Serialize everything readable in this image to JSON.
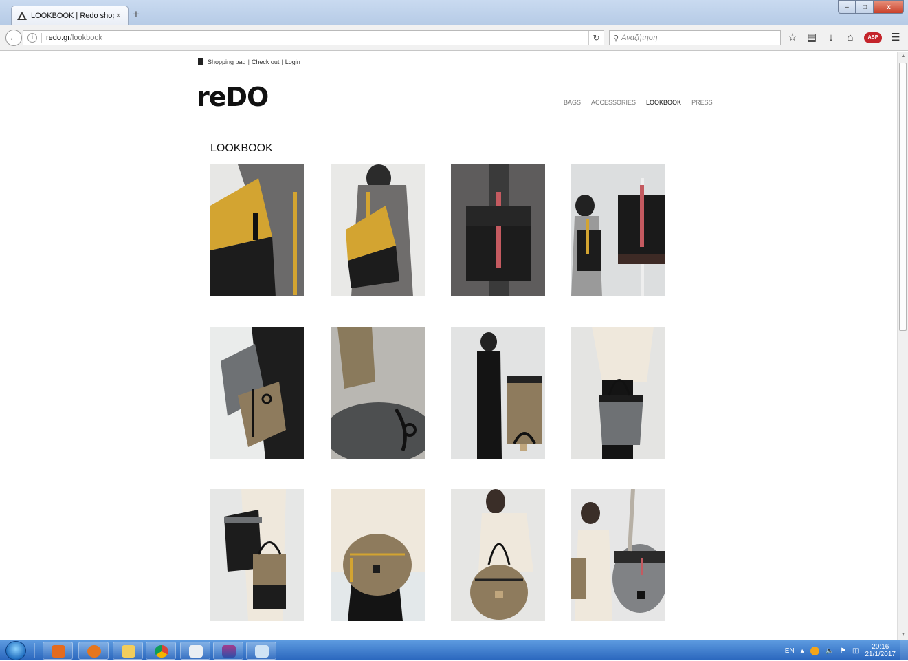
{
  "browser": {
    "tab_title": "LOOKBOOK | Redo shop",
    "tab_close": "×",
    "new_tab": "+",
    "url_host": "redo.gr",
    "url_path": "/lookbook",
    "search_placeholder": "Αναζήτηση",
    "abp_label": "ABP",
    "win_min": "–",
    "win_max": "□",
    "win_close": "x"
  },
  "page": {
    "header_links": {
      "bag": "Shopping bag",
      "checkout": "Check out",
      "login": "Login",
      "divider": "|"
    },
    "logo": "reDO",
    "nav": [
      "BAGS",
      "ACCESSORIES",
      "LOOKBOOK",
      "PRESS"
    ],
    "nav_active": "LOOKBOOK",
    "title": "LOOKBOOK"
  },
  "taskbar": {
    "lang": "EN",
    "time": "20:16",
    "date": "21/1/2017"
  },
  "colors": {
    "mustard": "#d3a431",
    "black_leather": "#1c1c1c",
    "red_strap": "#c45a60",
    "grey_wool": "#6e7174",
    "tan": "#8e7b5d"
  }
}
